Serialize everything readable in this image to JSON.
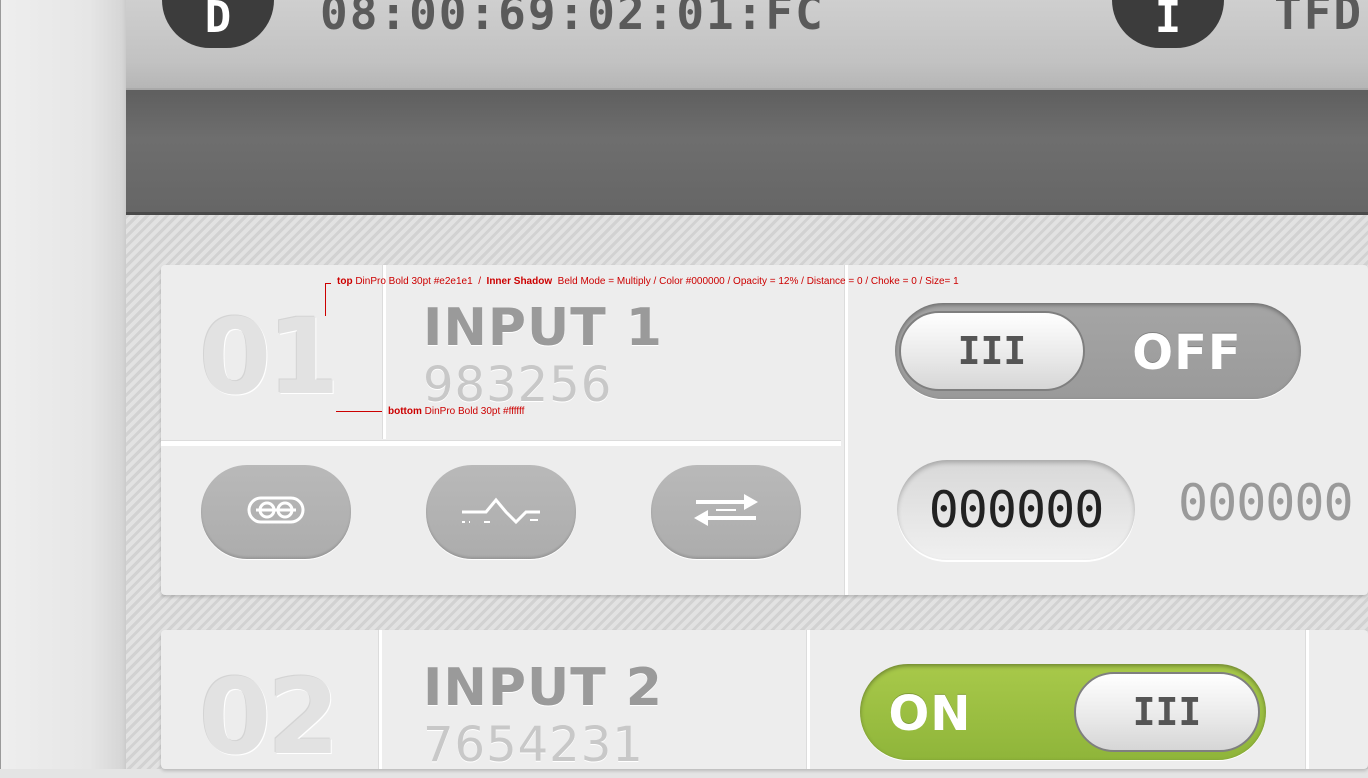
{
  "top_bar": {
    "badge_left": "D",
    "text_left": "08:00:69:02:01:FC",
    "badge_right": "I",
    "text_right": "TFD"
  },
  "annotations": {
    "top_label": "top",
    "top_spec": "DinPro Bold 30pt #e2e1e1",
    "separator": "/",
    "shadow_label": "Inner Shadow",
    "shadow_spec": "Beld Mode = Multiply / Color #000000 / Opacity = 12% / Distance = 0 / Choke = 0 / Size= 1",
    "bottom_label": "bottom",
    "bottom_spec": "DinPro Bold 30pt #ffffff"
  },
  "channels": [
    {
      "number": "01",
      "title": "INPUT 1",
      "code": "983256",
      "toggle_state": "OFF",
      "knob_glyph": "III",
      "counter_value": "000000",
      "counter_secondary": "000000",
      "buttons": [
        "link-icon",
        "waveform-icon",
        "swap-arrows-icon"
      ]
    },
    {
      "number": "02",
      "title": "INPUT 2",
      "code": "7654231",
      "toggle_state": "ON",
      "knob_glyph": "III"
    }
  ],
  "colors": {
    "on_green": "#9dc040",
    "annotation_red": "#cc0000",
    "number_top": "#e2e1e1",
    "number_bottom": "#ffffff"
  }
}
